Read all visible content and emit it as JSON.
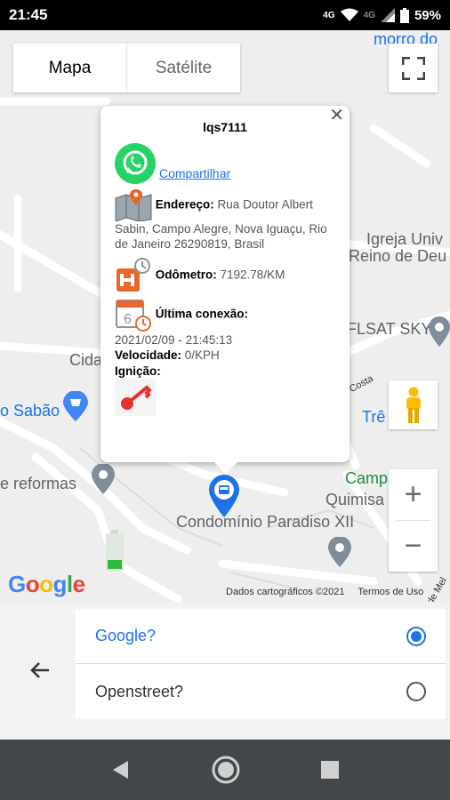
{
  "status_bar": {
    "time": "21:45",
    "signal_label": "4G",
    "signal_label2": "4G",
    "battery": "59%"
  },
  "map": {
    "tabs": [
      {
        "label": "Mapa"
      },
      {
        "label": "Satélite"
      }
    ],
    "labels": {
      "morro": "morro do",
      "igreja": "Igreja Univ",
      "reino": "Reino de Deu",
      "flsat": "FLSAT SKY",
      "cida": "Cida",
      "sabao": "o Sabão",
      "tre": "Trê",
      "reformas": "e reformas",
      "camp": "Camp",
      "quimisa": "Quimisa",
      "condominio": "Condomínio Paradiso XII",
      "street1": "Costa",
      "street2": "de Mel"
    },
    "google_logo": [
      "G",
      "o",
      "o",
      "g",
      "l",
      "e"
    ],
    "credits": "Dados cartográficos ©2021",
    "terms": "Termos de Uso"
  },
  "popup": {
    "title": "lqs7111",
    "share_label": "Compartilhar",
    "address_label": "Endereço:",
    "address_value": " Rua Doutor Albert Sabin, Campo Alegre, Nova Iguaçu, Rio de Janeiro 26290819, Brasil",
    "odometer_label": "Odômetro:",
    "odometer_value": " 7192.78/KM",
    "last_conn_label": "Última conexão:",
    "last_conn_value": "2021/02/09 - 21:45:13",
    "speed_label": "Velocidade:",
    "speed_value": " 0/KPH",
    "ignition_label": "Ignição:"
  },
  "options": [
    {
      "label": "Google?",
      "selected": true
    },
    {
      "label": "Openstreet?",
      "selected": false
    }
  ],
  "colors": {
    "accent": "#1a73e8",
    "nav_bar": "#41474b",
    "whatsapp": "#25d366"
  }
}
